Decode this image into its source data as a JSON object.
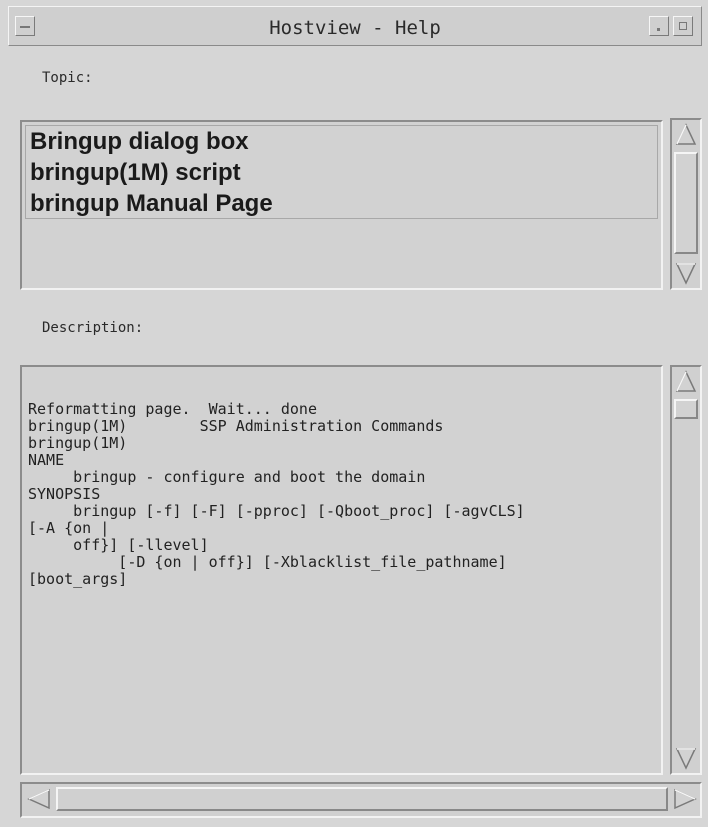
{
  "window": {
    "title": "Hostview - Help"
  },
  "topic": {
    "label": "Topic:",
    "items": [
      "Bringup dialog box",
      "bringup(1M) script",
      "bringup Manual Page"
    ]
  },
  "description": {
    "label": "Description:",
    "lines": [
      "",
      "",
      "",
      "Reformatting page.  Wait... done",
      "",
      "",
      "",
      "",
      "bringup(1M)        SSP Administration Commands",
      "bringup(1M)",
      "",
      "",
      "",
      "",
      "NAME",
      "     bringup - configure and boot the domain",
      "",
      "SYNOPSIS",
      "     bringup [-f] [-F] [-pproc] [-Qboot_proc] [-agvCLS]",
      "[-A {on |",
      "     off}] [-llevel]",
      "          [-D {on | off}] [-Xblacklist_file_pathname]",
      "[boot_args]"
    ]
  },
  "icons": {
    "menu": "window-menu-icon",
    "minimize": "minimize-icon",
    "maximize": "maximize-icon",
    "up": "scroll-up-arrow-icon",
    "down": "scroll-down-arrow-icon",
    "left": "scroll-left-arrow-icon",
    "right": "scroll-right-arrow-icon"
  },
  "colors": {
    "background": "#d6d6d6",
    "text": "#222222"
  }
}
